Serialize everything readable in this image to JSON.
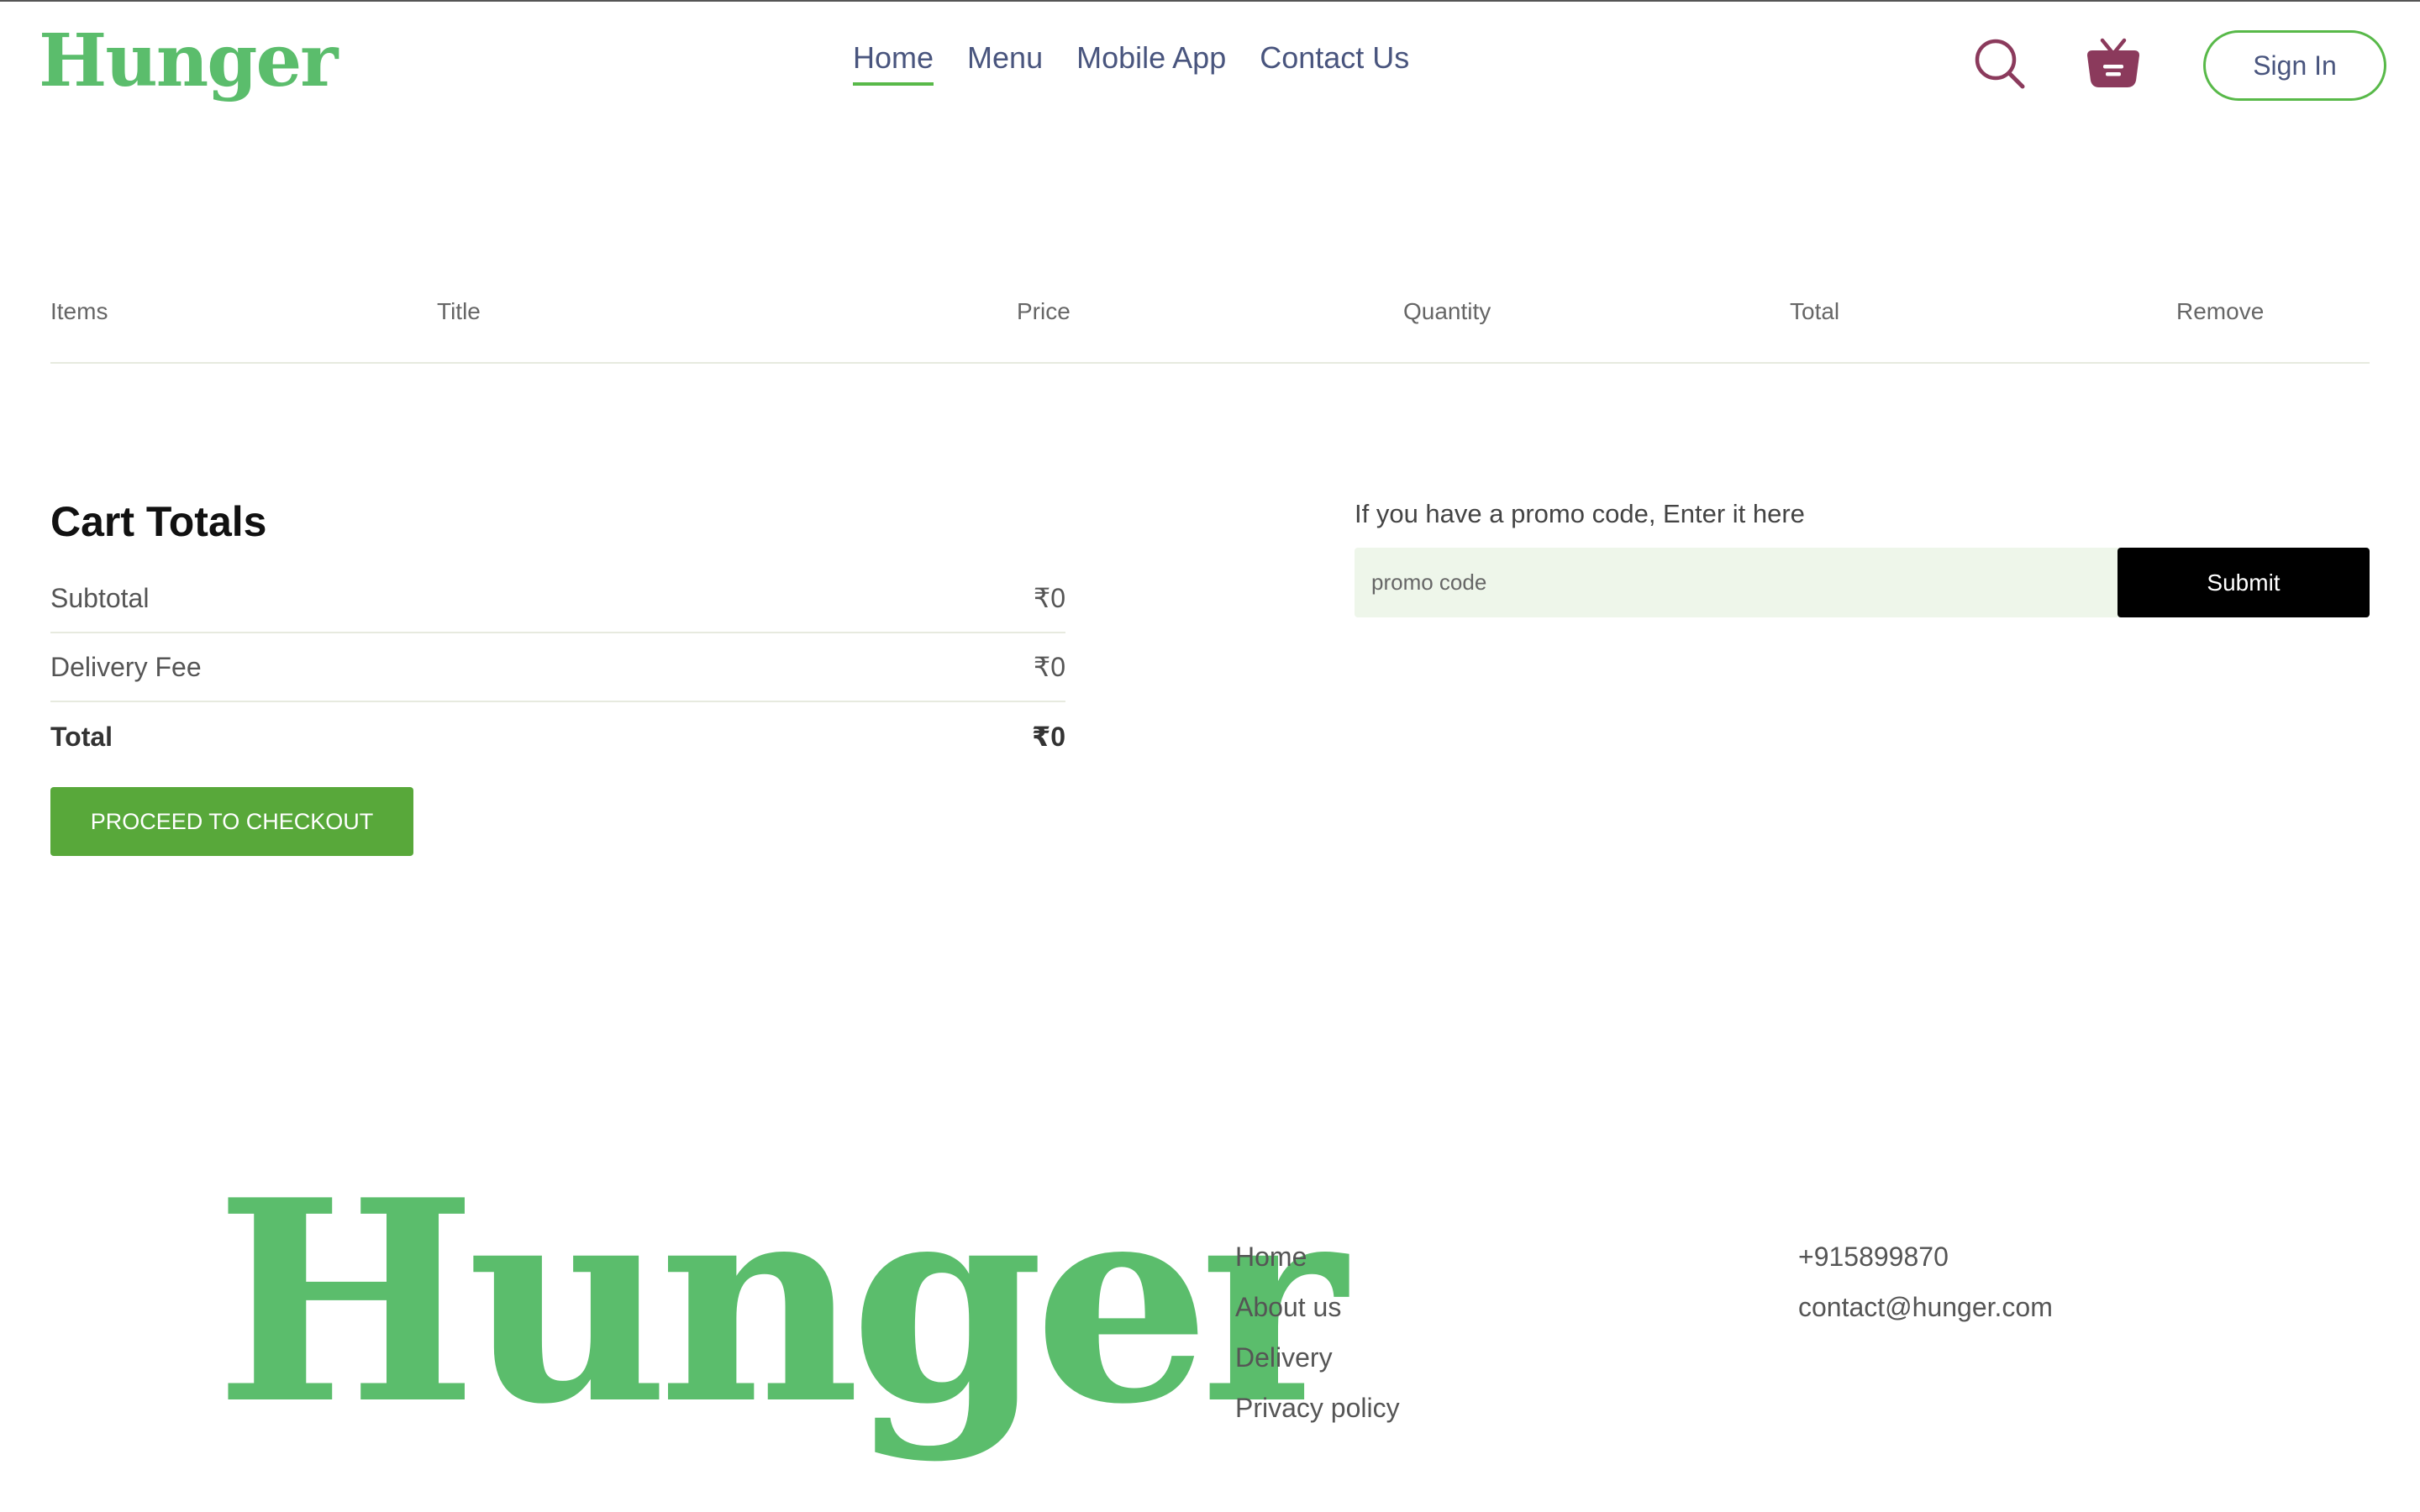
{
  "brand": {
    "name": "Hunger",
    "color": "#5bbd6c"
  },
  "nav": {
    "items": [
      {
        "label": "Home",
        "active": true
      },
      {
        "label": "Menu"
      },
      {
        "label": "Mobile App"
      },
      {
        "label": "Contact Us"
      }
    ],
    "search_icon": "search-icon",
    "basket_icon": "basket-icon",
    "signin_label": "Sign In"
  },
  "cart_table": {
    "headers": [
      "Items",
      "Title",
      "Price",
      "Quantity",
      "Total",
      "Remove"
    ],
    "rows": []
  },
  "cart_totals": {
    "title": "Cart Totals",
    "subtotal_label": "Subtotal",
    "subtotal_value": "₹0",
    "delivery_label": "Delivery Fee",
    "delivery_value": "₹0",
    "total_label": "Total",
    "total_value": "₹0",
    "checkout_label": "PROCEED TO CHECKOUT"
  },
  "promo": {
    "label": "If you have a promo code, Enter it here",
    "placeholder": "promo code",
    "submit_label": "Submit"
  },
  "footer": {
    "links": [
      "Home",
      "About us",
      "Delivery",
      "Privacy policy"
    ],
    "phone": "+915899870",
    "email": "contact@hunger.com"
  },
  "colors": {
    "accent": "#58b949",
    "checkout": "#58a83a",
    "nav_text": "#49557e",
    "basket": "#8b3a5c",
    "promo_bg": "#eef6ea"
  }
}
